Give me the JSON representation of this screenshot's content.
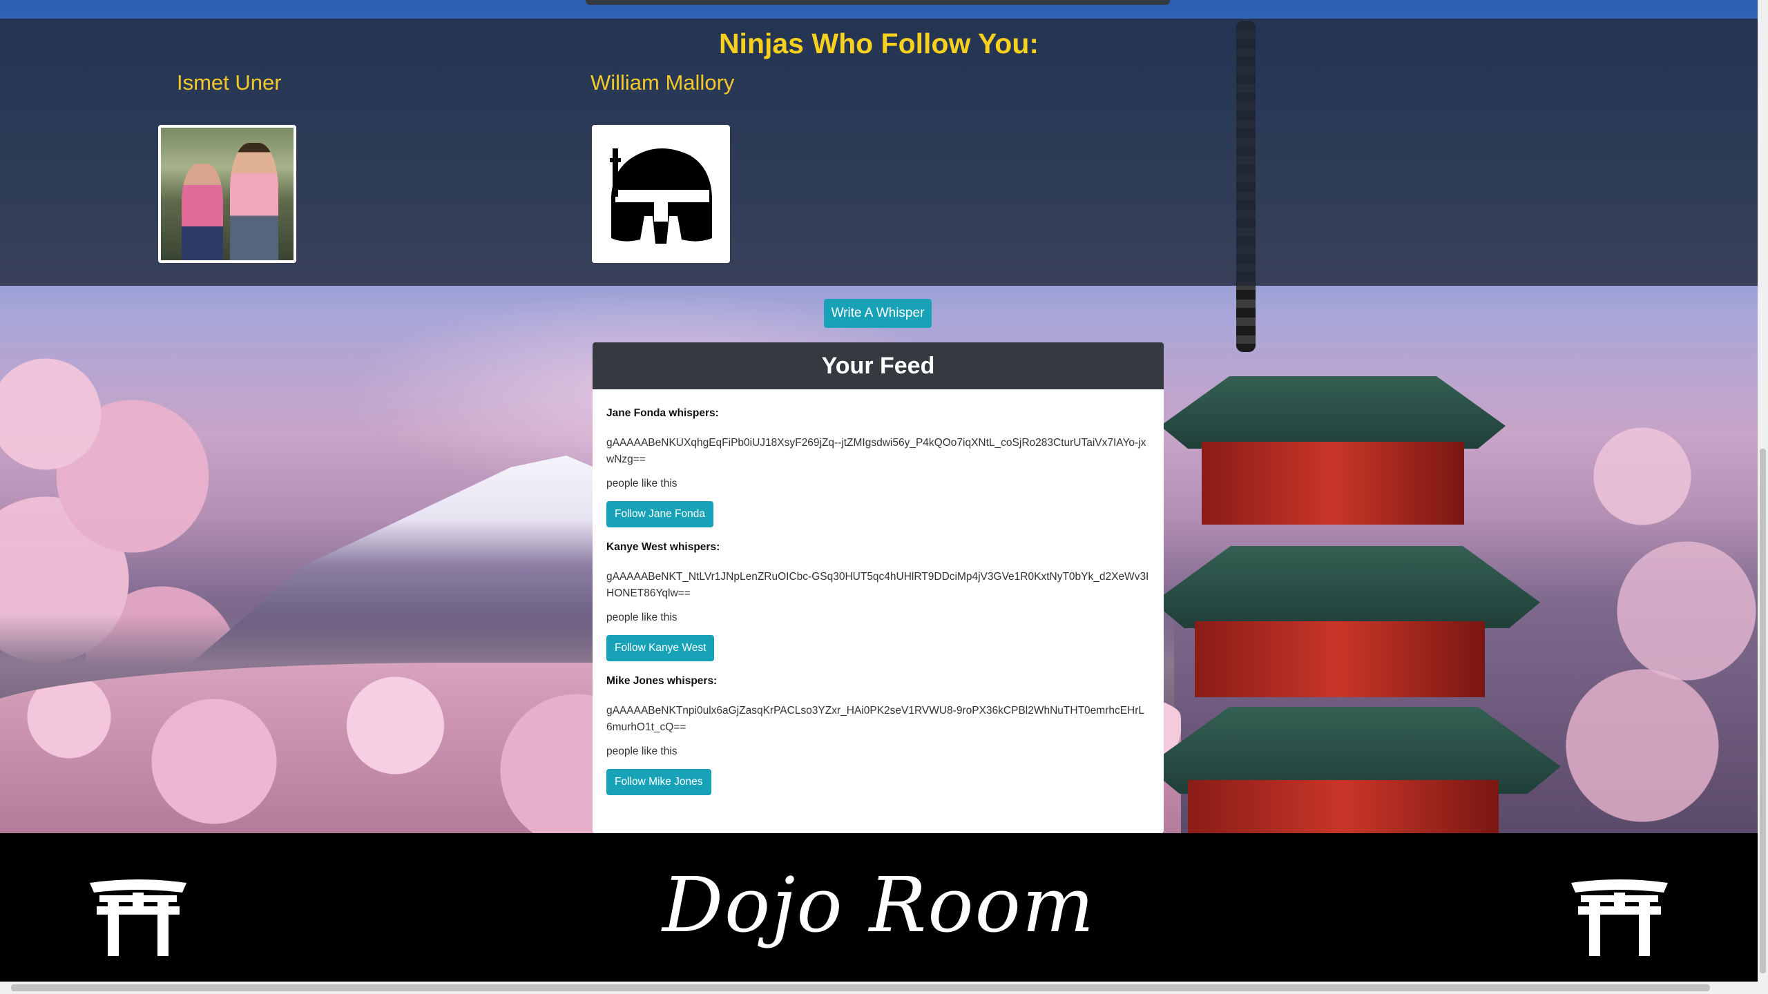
{
  "followers": {
    "title": "Ninjas Who Follow You:",
    "list": [
      {
        "name": "Ismet Uner",
        "avatar": "couple-photo"
      },
      {
        "name": "William Mallory",
        "avatar": "mandalorian-helmet-icon"
      }
    ]
  },
  "write_button": "Write A Whisper",
  "feed": {
    "title": "Your Feed",
    "posts": [
      {
        "author": "Jane Fonda whispers:",
        "message": "gAAAAABeNKUXqhgEqFiPb0iUJ18XsyF269jZq--jtZMIgsdwi56y_P4kQOo7iqXNtL_coSjRo283CturUTaiVx7IAYo-jxwNzg==",
        "likes": "people like this",
        "follow_label": "Follow Jane Fonda"
      },
      {
        "author": "Kanye West whispers:",
        "message": "gAAAAABeNKT_NtLVr1JNpLenZRuOICbc-GSq30HUT5qc4hUHlRT9DDciMp4jV3GVe1R0KxtNyT0bYk_d2XeWv3IHONET86Yqlw==",
        "likes": "people like this",
        "follow_label": "Follow Kanye West"
      },
      {
        "author": "Mike Jones whispers:",
        "message": "gAAAAABeNKTnpi0ulx6aGjZasqKrPACLso3YZxr_HAi0PK2seV1RVWU8-9roPX36kCPBl2WhNuTHT0emrhcEHrL6murhO1t_cQ==",
        "likes": "people like this",
        "follow_label": "Follow Mike Jones"
      }
    ]
  },
  "footer": {
    "logo_text": "Dojo Room",
    "left_icon": "torii-gate-icon",
    "right_icon": "torii-gate-icon"
  }
}
